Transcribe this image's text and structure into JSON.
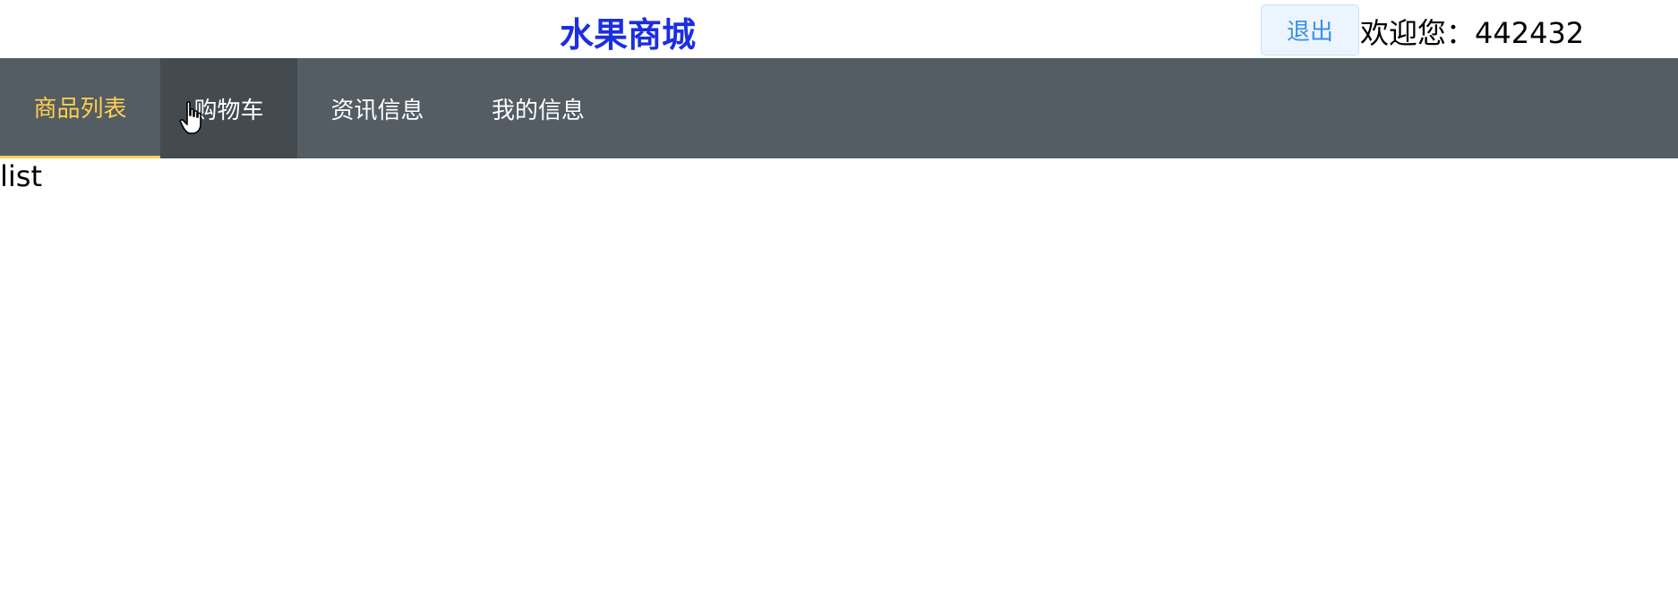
{
  "header": {
    "site_title": "水果商城",
    "logout_label": "退出",
    "welcome_text": "欢迎您：442432"
  },
  "nav": {
    "items": [
      {
        "label": "商品列表",
        "state": "active"
      },
      {
        "label": "购物车",
        "state": "hover"
      },
      {
        "label": "资讯信息",
        "state": "normal"
      },
      {
        "label": "我的信息",
        "state": "normal"
      }
    ]
  },
  "main": {
    "content_text": "list"
  },
  "colors": {
    "title": "#1b2ee0",
    "nav_bg": "#545c64",
    "nav_hover_bg": "#434a50",
    "nav_active": "#ffd04b",
    "logout_text": "#3a8ee6",
    "logout_bg": "#ecf5ff"
  },
  "icons": {
    "cursor": "hand-pointer-icon"
  }
}
